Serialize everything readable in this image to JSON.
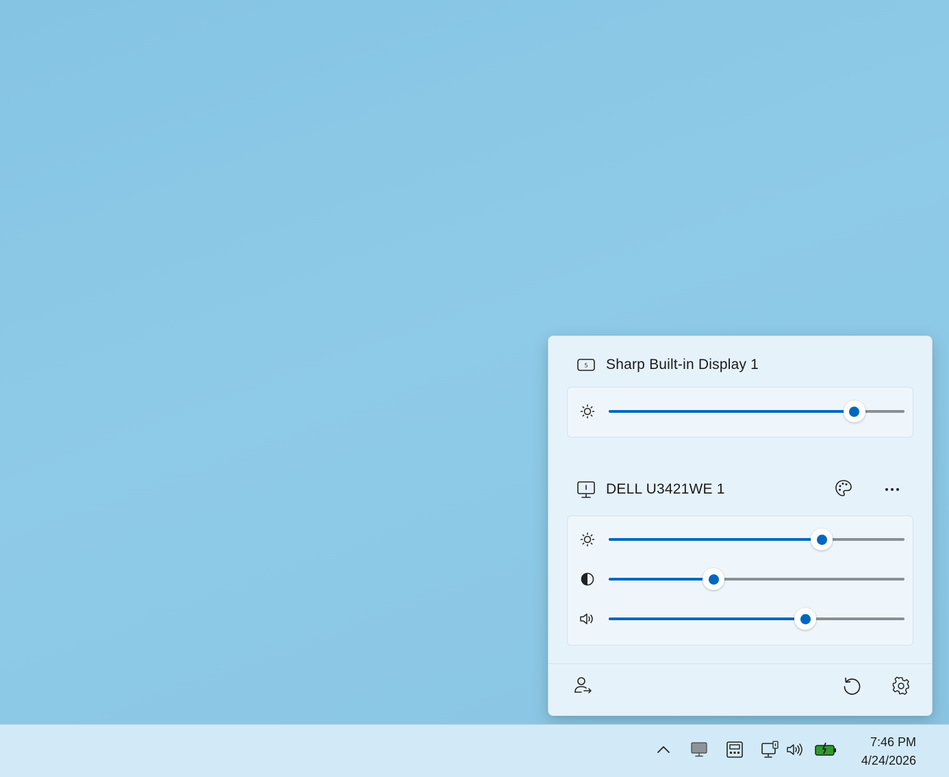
{
  "flyout": {
    "monitors": [
      {
        "name": "Sharp Built-in Display 1",
        "icon": "laptop-display-icon",
        "sliders": [
          {
            "type": "brightness",
            "icon": "brightness-icon",
            "value": 0.83
          }
        ]
      },
      {
        "name": "DELL U3421WE 1",
        "icon": "external-monitor-icon",
        "actions": [
          "color-palette-icon",
          "more-icon"
        ],
        "sliders": [
          {
            "type": "brightness",
            "icon": "brightness-icon",
            "value": 0.72
          },
          {
            "type": "contrast",
            "icon": "contrast-icon",
            "value": 0.355
          },
          {
            "type": "volume",
            "icon": "volume-icon",
            "value": 0.665
          }
        ]
      }
    ],
    "footer": {
      "left": "identify-user-icon",
      "right": [
        "reset-icon",
        "settings-icon"
      ]
    }
  },
  "taskbar": {
    "tray_icons": [
      "chevron-up-icon",
      "monitor-icon",
      "display-tray-icon",
      "network-icon",
      "volume-icon",
      "battery-charging-icon"
    ],
    "time": "7:46 PM",
    "date": "4/24/2026",
    "colors": {
      "accent": "#0067c0",
      "battery": "#2e9b2e"
    }
  }
}
